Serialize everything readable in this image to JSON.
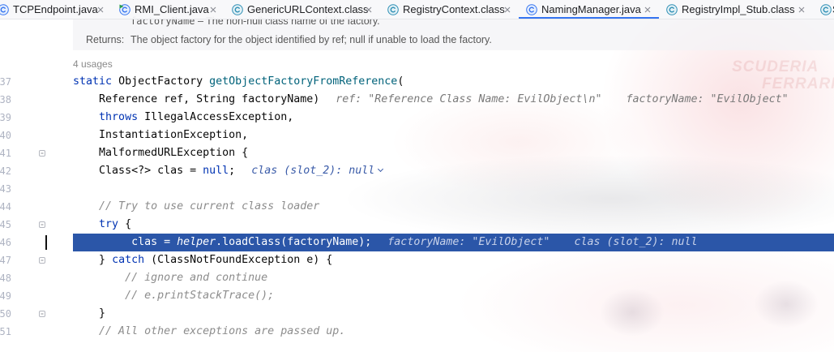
{
  "tabs": [
    {
      "label": "TCPEndpoint.java",
      "icon": "java-class-icon"
    },
    {
      "label": "RMI_Client.java",
      "icon": "runnable-java-class-icon"
    },
    {
      "label": "GenericURLContext.class",
      "icon": "compiled-class-icon"
    },
    {
      "label": "RegistryContext.class",
      "icon": "compiled-class-icon"
    },
    {
      "label": "NamingManager.java",
      "icon": "java-class-icon",
      "active": true
    },
    {
      "label": "RegistryImpl_Stub.class",
      "icon": "compiled-class-icon"
    },
    {
      "label": "S",
      "icon": "compiled-class-icon"
    }
  ],
  "doc": {
    "param_name": "factoryName",
    "param_desc": "– The non-null class name of the factory.",
    "returns_label": "Returns:",
    "returns_text": "The object factory for the object identified by ref; null if unable to load the factory."
  },
  "usages": "4 usages",
  "code": {
    "lines": [
      {
        "num": "37",
        "tokens": [
          {
            "text": "    static",
            "kind": "keyword"
          },
          {
            "text": " ObjectFactory ",
            "kind": "plain"
          },
          {
            "text": "getObjectFactoryFromReference",
            "kind": "method"
          },
          {
            "text": "(",
            "kind": "plain"
          }
        ]
      },
      {
        "num": "38",
        "tokens": [
          {
            "text": "        Reference ref, String factoryName)",
            "kind": "plain"
          }
        ],
        "hints": [
          {
            "text": "ref: \"Reference Class Name: EvilObject\\n\""
          },
          {
            "text": "factoryName: \"EvilObject\""
          }
        ]
      },
      {
        "num": "39",
        "tokens": [
          {
            "text": "        throws",
            "kind": "keyword"
          },
          {
            "text": " IllegalAccessException,",
            "kind": "plain"
          }
        ]
      },
      {
        "num": "40",
        "tokens": [
          {
            "text": "        InstantiationException,",
            "kind": "plain"
          }
        ]
      },
      {
        "num": "41",
        "fold": true,
        "tokens": [
          {
            "text": "        MalformedURLException {",
            "kind": "plain"
          }
        ]
      },
      {
        "num": "42",
        "tokens": [
          {
            "text": "        Class<?> clas = ",
            "kind": "plain"
          },
          {
            "text": "null",
            "kind": "keyword"
          },
          {
            "text": ";",
            "kind": "plain"
          }
        ],
        "hints": [
          {
            "text": "clas (slot_2): null",
            "expandable": true
          }
        ]
      },
      {
        "num": "43",
        "tokens": []
      },
      {
        "num": "44",
        "tokens": [
          {
            "text": "        // Try to use current class loader",
            "kind": "comment"
          }
        ]
      },
      {
        "num": "45",
        "fold": true,
        "tokens": [
          {
            "text": "        try",
            "kind": "keyword"
          },
          {
            "text": " {",
            "kind": "plain"
          }
        ]
      },
      {
        "num": "46",
        "current": true,
        "tokens": [
          {
            "text": "             clas = ",
            "kind": "plain"
          },
          {
            "text": "helper",
            "kind": "field"
          },
          {
            "text": ".loadClass(factoryName);",
            "kind": "plain"
          }
        ],
        "hints": [
          {
            "text": "factoryName: \"EvilObject\""
          },
          {
            "text": "clas (slot_2): null"
          }
        ]
      },
      {
        "num": "47",
        "fold": true,
        "tokens": [
          {
            "text": "        } ",
            "kind": "plain"
          },
          {
            "text": "catch",
            "kind": "keyword"
          },
          {
            "text": " (ClassNotFoundException e) {",
            "kind": "plain"
          }
        ]
      },
      {
        "num": "48",
        "tokens": [
          {
            "text": "            // ignore and continue",
            "kind": "comment"
          }
        ]
      },
      {
        "num": "49",
        "tokens": [
          {
            "text": "            // e.printStackTrace();",
            "kind": "comment"
          }
        ]
      },
      {
        "num": "50",
        "fold": true,
        "tokens": [
          {
            "text": "        }",
            "kind": "plain"
          }
        ]
      },
      {
        "num": "51",
        "tokens": [
          {
            "text": "        // All other exceptions are passed up.",
            "kind": "comment"
          }
        ]
      }
    ]
  },
  "background": {
    "watermark_lines": [
      "SCUDERIA",
      "FERRARI"
    ]
  },
  "colors": {
    "accent": "#3574f0",
    "execution_highlight": "#2b56a8",
    "keyword": "#0033b3",
    "method_declaration": "#00627a",
    "comment": "#8c8c8c",
    "field": "#871094",
    "inline_value": "#7a7a7a"
  }
}
